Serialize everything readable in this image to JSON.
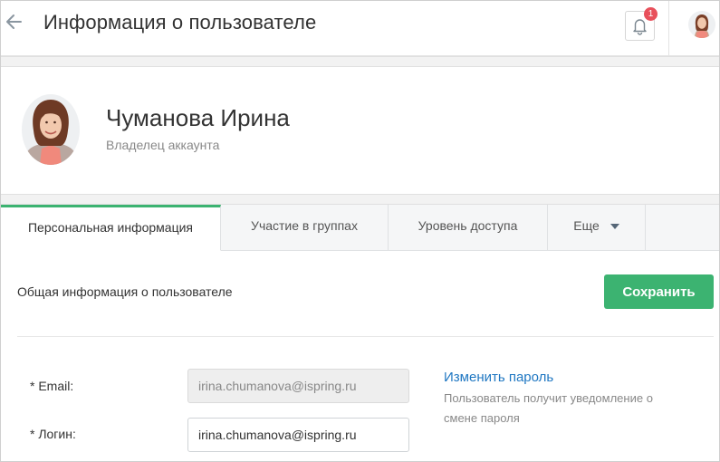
{
  "header": {
    "title": "Информация о пользователе",
    "notifications_count": "1",
    "icons": {
      "back": "arrow-left-icon",
      "bell": "bell-icon"
    }
  },
  "profile": {
    "name": "Чуманова Ирина",
    "role": "Владелец аккаунта"
  },
  "tabs": [
    {
      "label": "Персональная информация",
      "active": true
    },
    {
      "label": "Участие в группах",
      "active": false
    },
    {
      "label": "Уровень доступа",
      "active": false
    },
    {
      "label": "Еще",
      "active": false
    }
  ],
  "form": {
    "section_title": "Общая информация о пользователе",
    "save_label": "Сохранить",
    "email_label": "* Email:",
    "email_value": "irina.chumanova@ispring.ru",
    "login_label": "* Логин:",
    "login_value": "irina.chumanova@ispring.ru",
    "change_password_link": "Изменить пароль",
    "change_password_note": "Пользователь получит уведомление о смене пароля"
  },
  "colors": {
    "accent": "#3cb371",
    "link": "#1f77c2",
    "badge": "#e8505b"
  }
}
